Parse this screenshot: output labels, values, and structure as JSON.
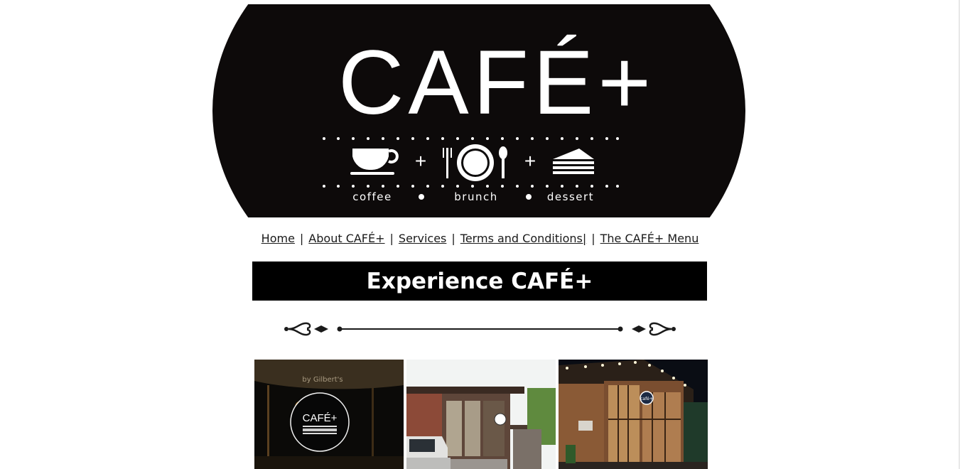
{
  "logo": {
    "title": "CAFÉ+",
    "tagline": [
      "coffee",
      "brunch",
      "dessert"
    ]
  },
  "nav": {
    "items": [
      {
        "label": "Home"
      },
      {
        "label": "About CAFÉ+"
      },
      {
        "label": "Services"
      },
      {
        "label": "Terms and Conditions|"
      },
      {
        "label": "The CAFÉ+ Menu"
      }
    ],
    "separator": "|"
  },
  "banner": {
    "title": "Experience CAFÉ+"
  },
  "gallery": {
    "photos": [
      {
        "subject": "night-sign",
        "sign_text": "CAFÉ+",
        "overhead_text": "by Gilbert's"
      },
      {
        "subject": "storefront-day"
      },
      {
        "subject": "storefront-night",
        "sign_text": "café+"
      }
    ]
  },
  "colors": {
    "logo_bg": "#0d0a0a",
    "logo_fg": "#ffffff",
    "banner_bg": "#000000",
    "banner_fg": "#ffffff",
    "link": "#1a1a1a"
  }
}
